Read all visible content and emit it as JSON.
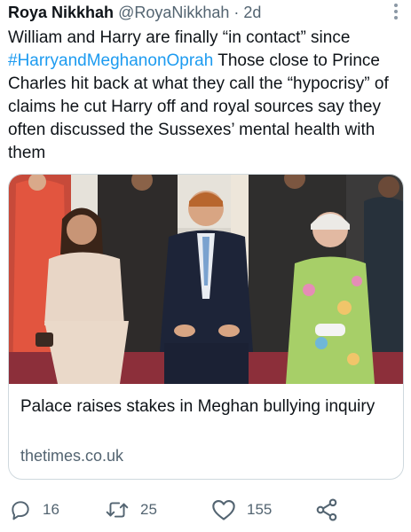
{
  "tweet": {
    "author_name": "Roya Nikkhah",
    "author_handle": "@RoyaNikkhah",
    "separator": "·",
    "time": "2d",
    "text_before_hashtag": "William and Harry are finally “in contact” since ",
    "hashtag": "#HarryandMeghanonOprah",
    "text_after_hashtag": " Those close to Prince Charles hit back at what they call the “hypocrisy” of claims he cut Harry off and royal sources say they often discussed the Sussexes’ mental health with them"
  },
  "card": {
    "title": "Palace raises stakes in Meghan bullying inquiry",
    "domain": "thetimes.co.uk"
  },
  "actions": {
    "reply_count": "16",
    "retweet_count": "25",
    "like_count": "155"
  },
  "icons": {
    "more": "more-vertical-icon",
    "reply": "reply-icon",
    "retweet": "retweet-icon",
    "like": "heart-icon",
    "share": "share-icon"
  },
  "colors": {
    "text": "#0f1419",
    "secondary": "#536471",
    "link": "#1d9bf0",
    "border": "#cfd9de"
  }
}
